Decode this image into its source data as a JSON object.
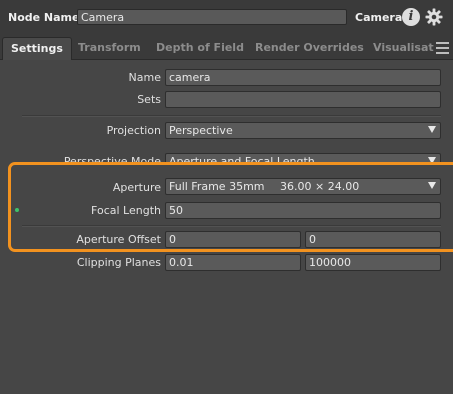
{
  "header": {
    "node_name_label": "Node Name",
    "node_name_value": "Camera",
    "node_type": "Camera"
  },
  "tabs": [
    {
      "label": "Settings",
      "active": true
    },
    {
      "label": "Transform",
      "active": false
    },
    {
      "label": "Depth of Field",
      "active": false
    },
    {
      "label": "Render Overrides",
      "active": false
    },
    {
      "label": "Visualisation",
      "active": false
    }
  ],
  "settings": {
    "name_label": "Name",
    "name_value": "camera",
    "sets_label": "Sets",
    "sets_value": "",
    "projection_label": "Projection",
    "projection_value": "Perspective",
    "perspective_mode_label": "Perspective Mode",
    "perspective_mode_value": "Aperture and Focal Length",
    "aperture_label": "Aperture",
    "aperture_preset": "Full Frame 35mm",
    "aperture_dims": "36.00 × 24.00",
    "focal_length_label": "Focal Length",
    "focal_length_value": "50",
    "aperture_offset_label": "Aperture Offset",
    "aperture_offset_x": "0",
    "aperture_offset_y": "0",
    "clipping_planes_label": "Clipping Planes",
    "clipping_near": "0.01",
    "clipping_far": "100000"
  },
  "colors": {
    "highlight": "#f2921f",
    "keyed_dot": "#3fbf6a"
  }
}
